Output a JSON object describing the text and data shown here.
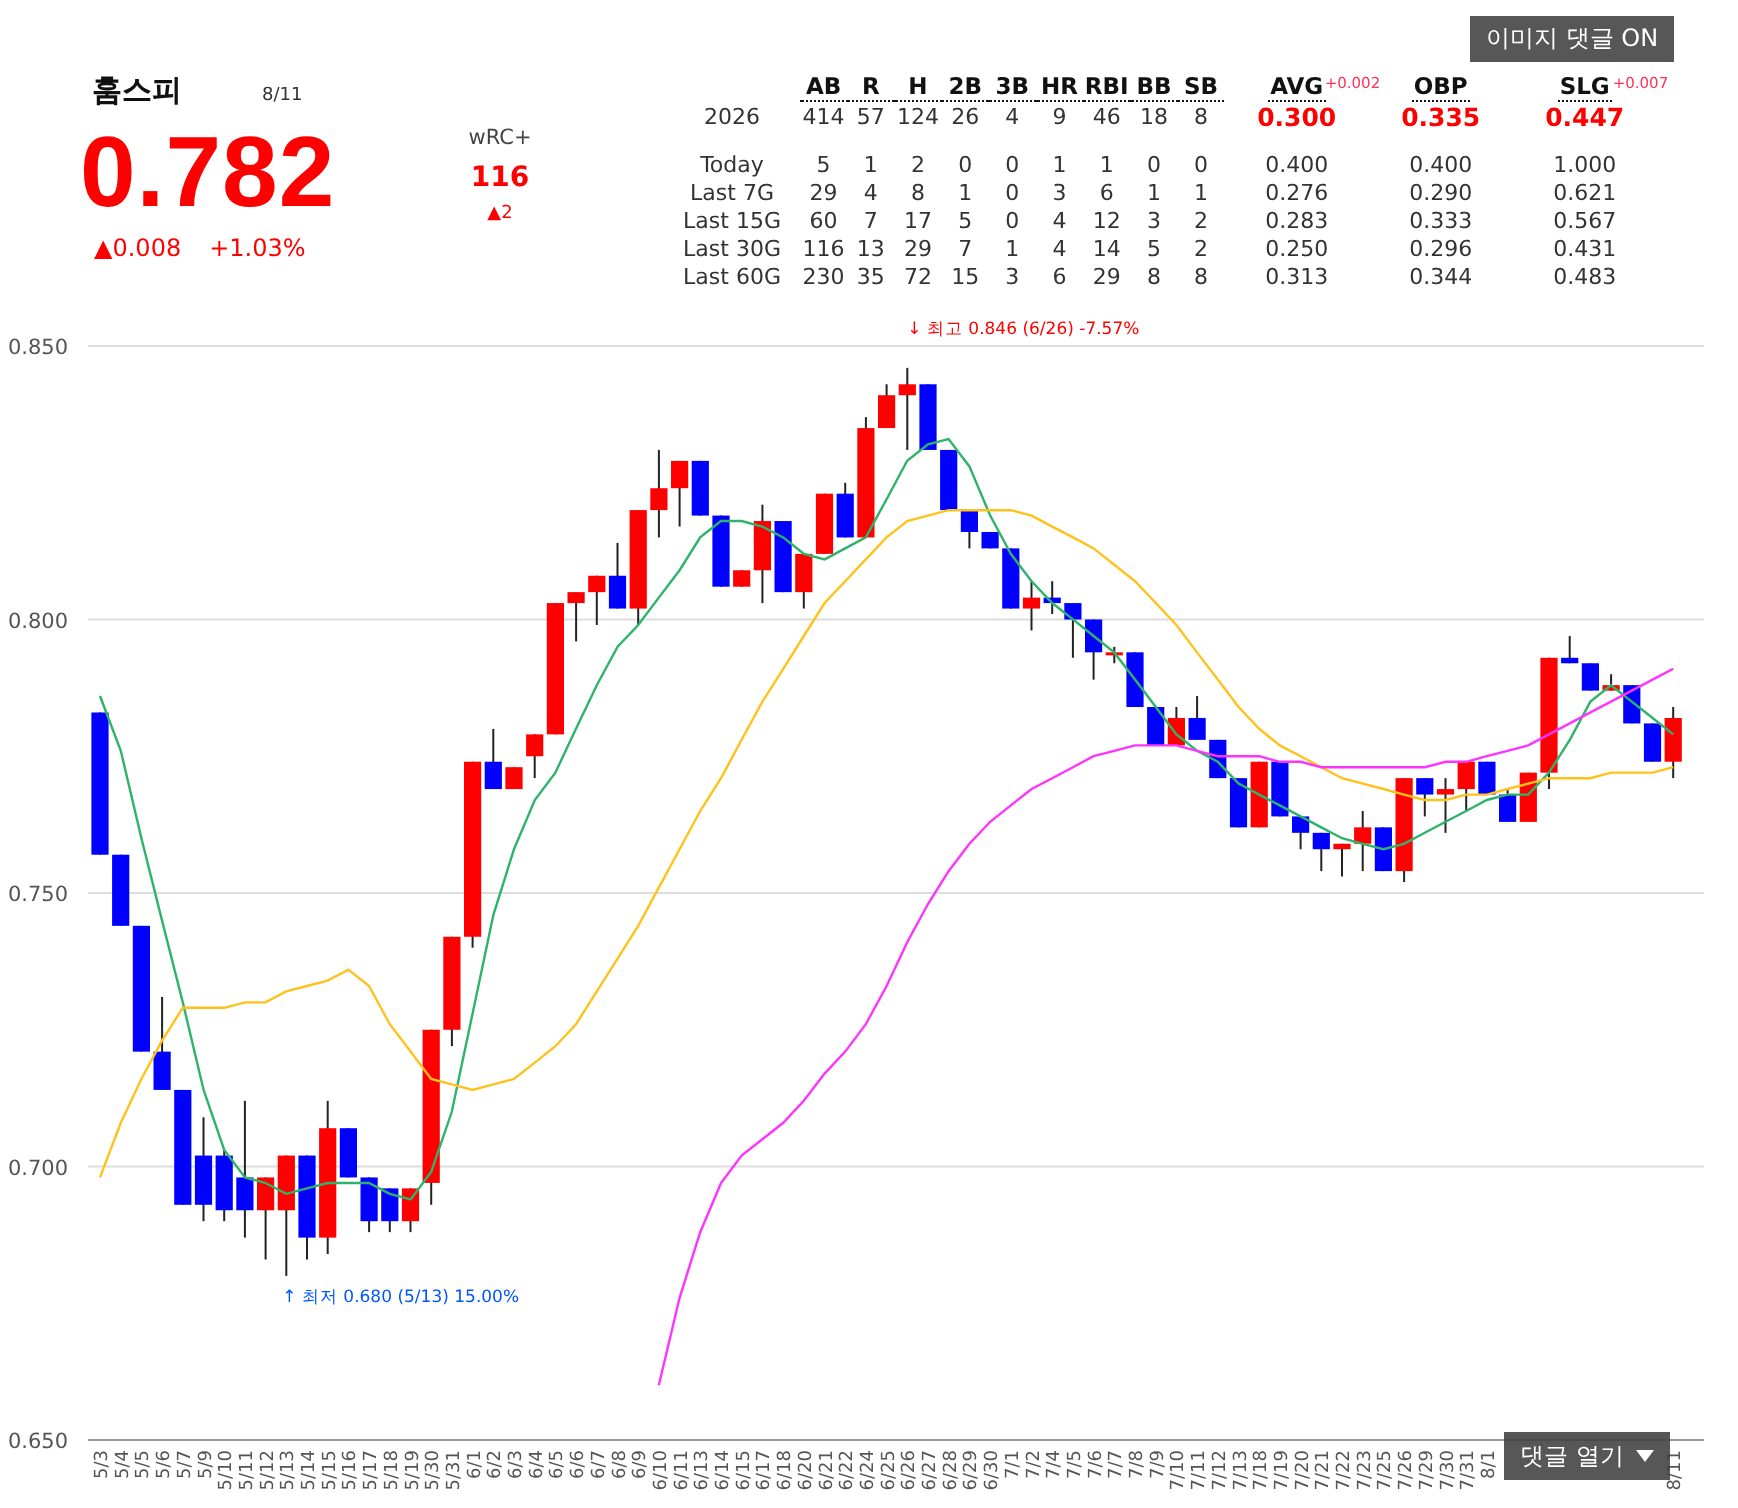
{
  "player": {
    "name": "훔스피",
    "date": "8/11",
    "value": "0.782",
    "change": "▲0.008",
    "change_pct": "+1.03%"
  },
  "wrc": {
    "label": "wRC+",
    "value": "116",
    "change": "▲2"
  },
  "stats": {
    "columns": [
      "AB",
      "R",
      "H",
      "2B",
      "3B",
      "HR",
      "RBI",
      "BB",
      "SB"
    ],
    "rate_columns": [
      {
        "label": "AVG",
        "change": "+0.002",
        "value": "0.300"
      },
      {
        "label": "OBP",
        "value": "0.335"
      },
      {
        "label": "SLG",
        "change": "+0.007",
        "value": "0.447"
      }
    ],
    "season": {
      "label": "2026",
      "values": [
        "414",
        "57",
        "124",
        "26",
        "4",
        "9",
        "46",
        "18",
        "8"
      ]
    },
    "splits": [
      {
        "label": "Today",
        "values": [
          "5",
          "1",
          "2",
          "0",
          "0",
          "1",
          "1",
          "0",
          "0"
        ],
        "rates": [
          "0.400",
          "0.400",
          "1.000"
        ]
      },
      {
        "label": "Last 7G",
        "values": [
          "29",
          "4",
          "8",
          "1",
          "0",
          "3",
          "6",
          "1",
          "1"
        ],
        "rates": [
          "0.276",
          "0.290",
          "0.621"
        ]
      },
      {
        "label": "Last 15G",
        "values": [
          "60",
          "7",
          "17",
          "5",
          "0",
          "4",
          "12",
          "3",
          "2"
        ],
        "rates": [
          "0.283",
          "0.333",
          "0.567"
        ]
      },
      {
        "label": "Last 30G",
        "values": [
          "116",
          "13",
          "29",
          "7",
          "1",
          "4",
          "14",
          "5",
          "2"
        ],
        "rates": [
          "0.250",
          "0.296",
          "0.431"
        ]
      },
      {
        "label": "Last 60G",
        "values": [
          "230",
          "35",
          "72",
          "15",
          "3",
          "6",
          "29",
          "8",
          "8"
        ],
        "rates": [
          "0.313",
          "0.344",
          "0.483"
        ]
      }
    ]
  },
  "image_comment_button": {
    "label": "이미지 댓글 ON"
  },
  "chart": {
    "chart_data": {
      "type": "candlestick",
      "grid": true,
      "categories": [
        "5/3",
        "5/4",
        "5/5",
        "5/6",
        "5/7",
        "5/9",
        "5/10",
        "5/11",
        "5/12",
        "5/13",
        "5/14",
        "5/15",
        "5/16",
        "5/17",
        "5/18",
        "5/19",
        "5/30",
        "5/31",
        "6/1",
        "6/2",
        "6/3",
        "6/4",
        "6/5",
        "6/6",
        "6/7",
        "6/8",
        "6/9",
        "6/10",
        "6/11",
        "6/13",
        "6/14",
        "6/15",
        "6/17",
        "6/18",
        "6/20",
        "6/21",
        "6/22",
        "6/24",
        "6/25",
        "6/26",
        "6/27",
        "6/28",
        "6/29",
        "6/30",
        "7/1",
        "7/2",
        "7/4",
        "7/5",
        "7/6",
        "7/7",
        "7/8",
        "7/9",
        "7/10",
        "7/11",
        "7/12",
        "7/13",
        "7/18",
        "7/19",
        "7/20",
        "7/21",
        "7/22",
        "7/23",
        "7/25",
        "7/26",
        "7/29",
        "7/30",
        "7/31",
        "8/1",
        null,
        null,
        null,
        null,
        null,
        null,
        null,
        null,
        "8/11"
      ],
      "ylim": [
        0.65,
        0.85
      ],
      "yticks": [
        {
          "value": 0.65,
          "label": "0.650"
        },
        {
          "value": 0.7,
          "label": "0.700"
        },
        {
          "value": 0.75,
          "label": "0.750"
        },
        {
          "value": 0.8,
          "label": "0.800"
        },
        {
          "value": 0.85,
          "label": "0.850"
        }
      ],
      "ohlc": [
        [
          0.783,
          0.783,
          0.757,
          0.757
        ],
        [
          0.757,
          0.757,
          0.744,
          0.744
        ],
        [
          0.744,
          0.744,
          0.721,
          0.721
        ],
        [
          0.721,
          0.731,
          0.714,
          0.714
        ],
        [
          0.714,
          0.714,
          0.693,
          0.693
        ],
        [
          0.702,
          0.709,
          0.69,
          0.693
        ],
        [
          0.702,
          0.703,
          0.69,
          0.692
        ],
        [
          0.698,
          0.712,
          0.687,
          0.692
        ],
        [
          0.692,
          0.698,
          0.683,
          0.698
        ],
        [
          0.692,
          0.702,
          0.68,
          0.702
        ],
        [
          0.702,
          0.702,
          0.683,
          0.687
        ],
        [
          0.687,
          0.712,
          0.684,
          0.707
        ],
        [
          0.707,
          0.707,
          0.698,
          0.698
        ],
        [
          0.698,
          0.698,
          0.688,
          0.69
        ],
        [
          0.696,
          0.696,
          0.688,
          0.69
        ],
        [
          0.69,
          0.696,
          0.688,
          0.696
        ],
        [
          0.697,
          0.725,
          0.693,
          0.725
        ],
        [
          0.725,
          0.742,
          0.722,
          0.742
        ],
        [
          0.742,
          0.774,
          0.74,
          0.774
        ],
        [
          0.774,
          0.78,
          0.769,
          0.769
        ],
        [
          0.769,
          0.773,
          0.769,
          0.773
        ],
        [
          0.775,
          0.779,
          0.771,
          0.779
        ],
        [
          0.779,
          0.803,
          0.779,
          0.803
        ],
        [
          0.803,
          0.805,
          0.796,
          0.805
        ],
        [
          0.805,
          0.808,
          0.799,
          0.808
        ],
        [
          0.808,
          0.814,
          0.802,
          0.802
        ],
        [
          0.802,
          0.82,
          0.799,
          0.82
        ],
        [
          0.82,
          0.831,
          0.815,
          0.824
        ],
        [
          0.824,
          0.829,
          0.817,
          0.829
        ],
        [
          0.829,
          0.829,
          0.819,
          0.819
        ],
        [
          0.819,
          0.819,
          0.806,
          0.806
        ],
        [
          0.806,
          0.809,
          0.806,
          0.809
        ],
        [
          0.809,
          0.821,
          0.803,
          0.818
        ],
        [
          0.818,
          0.818,
          0.805,
          0.805
        ],
        [
          0.805,
          0.812,
          0.802,
          0.812
        ],
        [
          0.812,
          0.823,
          0.812,
          0.823
        ],
        [
          0.823,
          0.825,
          0.815,
          0.815
        ],
        [
          0.815,
          0.837,
          0.815,
          0.835
        ],
        [
          0.835,
          0.843,
          0.835,
          0.841
        ],
        [
          0.841,
          0.846,
          0.831,
          0.843
        ],
        [
          0.843,
          0.843,
          0.831,
          0.831
        ],
        [
          0.831,
          0.831,
          0.82,
          0.82
        ],
        [
          0.82,
          0.82,
          0.813,
          0.816
        ],
        [
          0.816,
          0.816,
          0.813,
          0.813
        ],
        [
          0.813,
          0.813,
          0.802,
          0.802
        ],
        [
          0.802,
          0.807,
          0.798,
          0.804
        ],
        [
          0.804,
          0.807,
          0.801,
          0.803
        ],
        [
          0.803,
          0.803,
          0.793,
          0.8
        ],
        [
          0.8,
          0.8,
          0.789,
          0.794
        ],
        [
          0.794,
          0.795,
          0.792,
          0.794
        ],
        [
          0.794,
          0.794,
          0.784,
          0.784
        ],
        [
          0.784,
          0.784,
          0.777,
          0.777
        ],
        [
          0.777,
          0.784,
          0.777,
          0.782
        ],
        [
          0.782,
          0.786,
          0.778,
          0.778
        ],
        [
          0.778,
          0.778,
          0.771,
          0.771
        ],
        [
          0.771,
          0.771,
          0.762,
          0.762
        ],
        [
          0.762,
          0.774,
          0.762,
          0.774
        ],
        [
          0.774,
          0.774,
          0.764,
          0.764
        ],
        [
          0.764,
          0.764,
          0.758,
          0.761
        ],
        [
          0.761,
          0.761,
          0.754,
          0.758
        ],
        [
          0.758,
          0.759,
          0.753,
          0.759
        ],
        [
          0.759,
          0.765,
          0.754,
          0.762
        ],
        [
          0.762,
          0.762,
          0.754,
          0.754
        ],
        [
          0.754,
          0.771,
          0.752,
          0.771
        ],
        [
          0.771,
          0.771,
          0.764,
          0.768
        ],
        [
          0.768,
          0.771,
          0.761,
          0.769
        ],
        [
          0.769,
          0.774,
          0.765,
          0.774
        ],
        [
          0.774,
          0.774,
          0.768,
          0.768
        ],
        [
          0.768,
          0.769,
          0.763,
          0.763
        ],
        [
          0.763,
          0.772,
          0.763,
          0.772
        ],
        [
          0.772,
          0.793,
          0.769,
          0.793
        ],
        [
          0.793,
          0.797,
          0.792,
          0.792
        ],
        [
          0.792,
          0.792,
          0.787,
          0.787
        ],
        [
          0.787,
          0.79,
          0.787,
          0.788
        ],
        [
          0.788,
          0.788,
          0.781,
          0.781
        ],
        [
          0.781,
          0.781,
          0.774,
          0.774
        ],
        [
          0.774,
          0.784,
          0.771,
          0.782
        ]
      ],
      "series": [
        {
          "type": "line",
          "color": "#2eb36a",
          "values": [
            0.786,
            0.776,
            0.76,
            0.745,
            0.73,
            0.714,
            0.703,
            0.698,
            0.697,
            0.695,
            0.696,
            0.697,
            0.697,
            0.697,
            0.695,
            0.694,
            0.699,
            0.71,
            0.728,
            0.746,
            0.758,
            0.767,
            0.772,
            0.78,
            0.788,
            0.795,
            0.799,
            0.804,
            0.809,
            0.815,
            0.818,
            0.818,
            0.817,
            0.815,
            0.812,
            0.811,
            0.813,
            0.815,
            0.822,
            0.829,
            0.832,
            0.833,
            0.828,
            0.819,
            0.812,
            0.807,
            0.803,
            0.8,
            0.797,
            0.794,
            0.789,
            0.784,
            0.779,
            0.776,
            0.774,
            0.77,
            0.768,
            0.766,
            0.764,
            0.762,
            0.76,
            0.759,
            0.758,
            0.759,
            0.761,
            0.763,
            0.765,
            0.767,
            0.768,
            0.768,
            0.772,
            0.778,
            0.785,
            0.788,
            0.785,
            0.782,
            0.779
          ]
        },
        {
          "type": "line",
          "color": "#ffc21a",
          "values": [
            0.698,
            0.708,
            0.716,
            0.723,
            0.729,
            0.729,
            0.729,
            0.73,
            0.73,
            0.732,
            0.733,
            0.734,
            0.736,
            0.733,
            0.726,
            0.721,
            0.716,
            0.715,
            0.714,
            0.715,
            0.716,
            0.719,
            0.722,
            0.726,
            0.732,
            0.738,
            0.744,
            0.751,
            0.758,
            0.765,
            0.771,
            0.778,
            0.785,
            0.791,
            0.797,
            0.803,
            0.807,
            0.811,
            0.815,
            0.818,
            0.819,
            0.82,
            0.82,
            0.82,
            0.82,
            0.819,
            0.817,
            0.815,
            0.813,
            0.81,
            0.807,
            0.803,
            0.799,
            0.794,
            0.789,
            0.784,
            0.78,
            0.777,
            0.775,
            0.773,
            0.771,
            0.77,
            0.769,
            0.768,
            0.767,
            0.767,
            0.768,
            0.768,
            0.769,
            0.77,
            0.771,
            0.771,
            0.771,
            0.772,
            0.772,
            0.772,
            0.773
          ]
        },
        {
          "type": "line",
          "color": "#ff33ff",
          "values": [
            null,
            null,
            null,
            null,
            null,
            null,
            null,
            null,
            null,
            null,
            null,
            null,
            null,
            null,
            null,
            null,
            null,
            null,
            null,
            null,
            null,
            null,
            null,
            null,
            null,
            null,
            null,
            0.66,
            0.676,
            0.688,
            0.697,
            0.702,
            0.705,
            0.708,
            0.712,
            0.717,
            0.721,
            0.726,
            0.733,
            0.741,
            0.748,
            0.754,
            0.759,
            0.763,
            0.766,
            0.769,
            0.771,
            0.773,
            0.775,
            0.776,
            0.777,
            0.777,
            0.777,
            0.776,
            0.775,
            0.775,
            0.775,
            0.774,
            0.774,
            0.773,
            0.773,
            0.773,
            0.773,
            0.773,
            0.773,
            0.774,
            0.774,
            0.775,
            0.776,
            0.777,
            0.779,
            0.781,
            0.783,
            0.785,
            0.787,
            0.789,
            0.791
          ]
        }
      ],
      "annotations": [
        "↓ 최고 0.846 (6/26) -7.57%",
        "↑ 최저 0.680 (5/13) 15.00%"
      ]
    }
  },
  "comment_toggle": {
    "label": "댓글 열기"
  }
}
